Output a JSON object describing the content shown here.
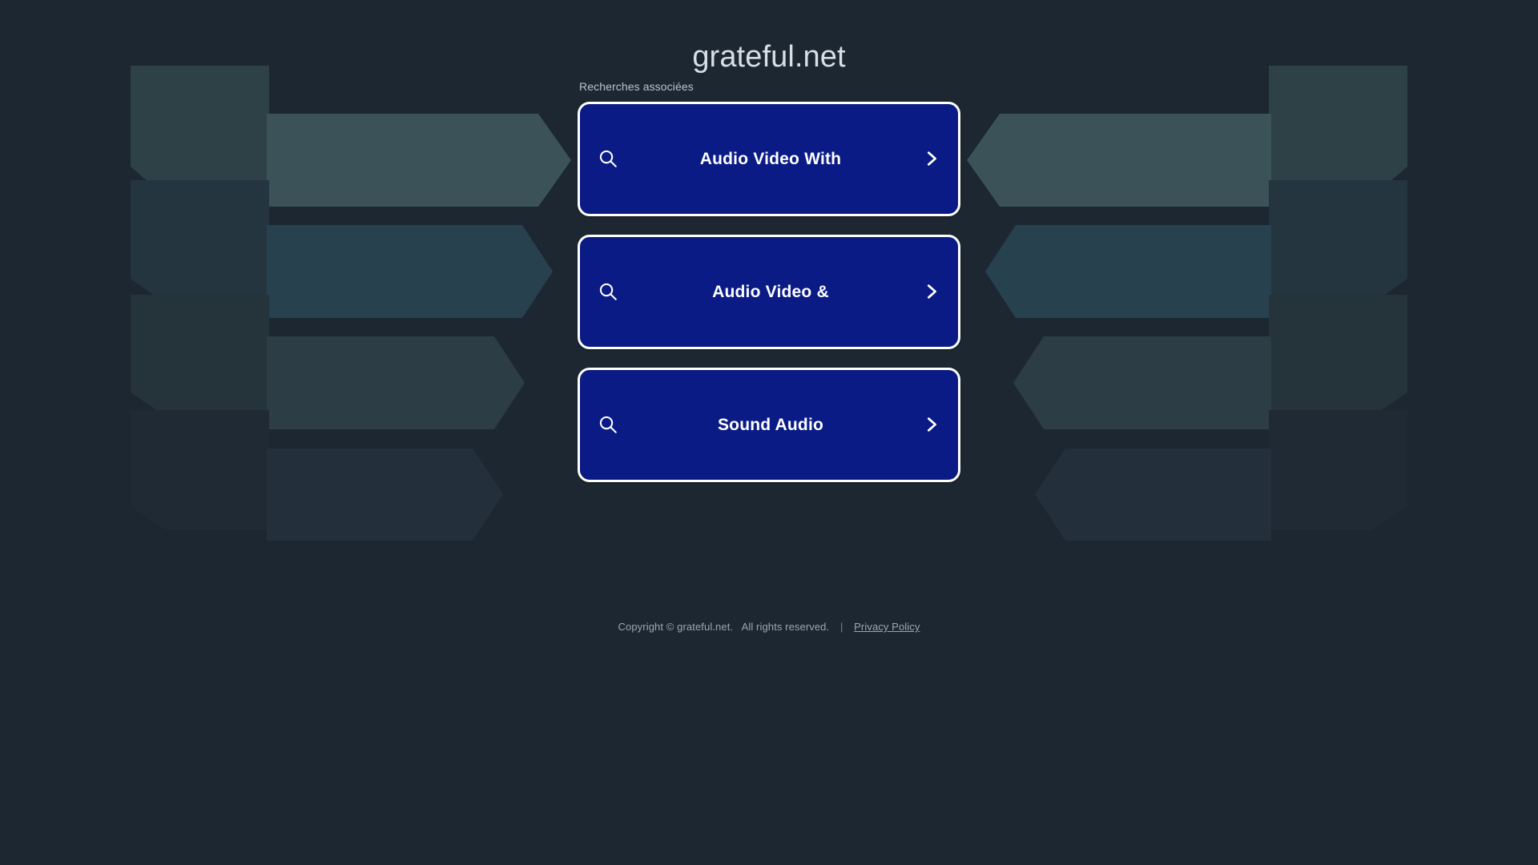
{
  "site": {
    "title": "grateful.net",
    "background_color": "#1c2731"
  },
  "related": {
    "label": "Recherches associées",
    "items": [
      {
        "label": "Audio Video With",
        "search_icon": "search-icon",
        "chevron_icon": "chevron-right-icon"
      },
      {
        "label": "Audio Video &",
        "search_icon": "search-icon",
        "chevron_icon": "chevron-right-icon"
      },
      {
        "label": "Sound Audio",
        "search_icon": "search-icon",
        "chevron_icon": "chevron-right-icon"
      }
    ],
    "button_color": "#0a1b86",
    "button_border_color": "#ffffff"
  },
  "footer": {
    "copyright": "Copyright © grateful.net.",
    "rights": "All rights reserved.",
    "separator": "|",
    "privacy_label": "Privacy Policy"
  },
  "decor": {
    "band_colors": [
      "#3b5259",
      "#28414f",
      "#2c3d46",
      "#232f3a"
    ],
    "band_colors_dim": [
      "#2e4147",
      "#24353f",
      "#25333b",
      "#1f2a34"
    ]
  }
}
